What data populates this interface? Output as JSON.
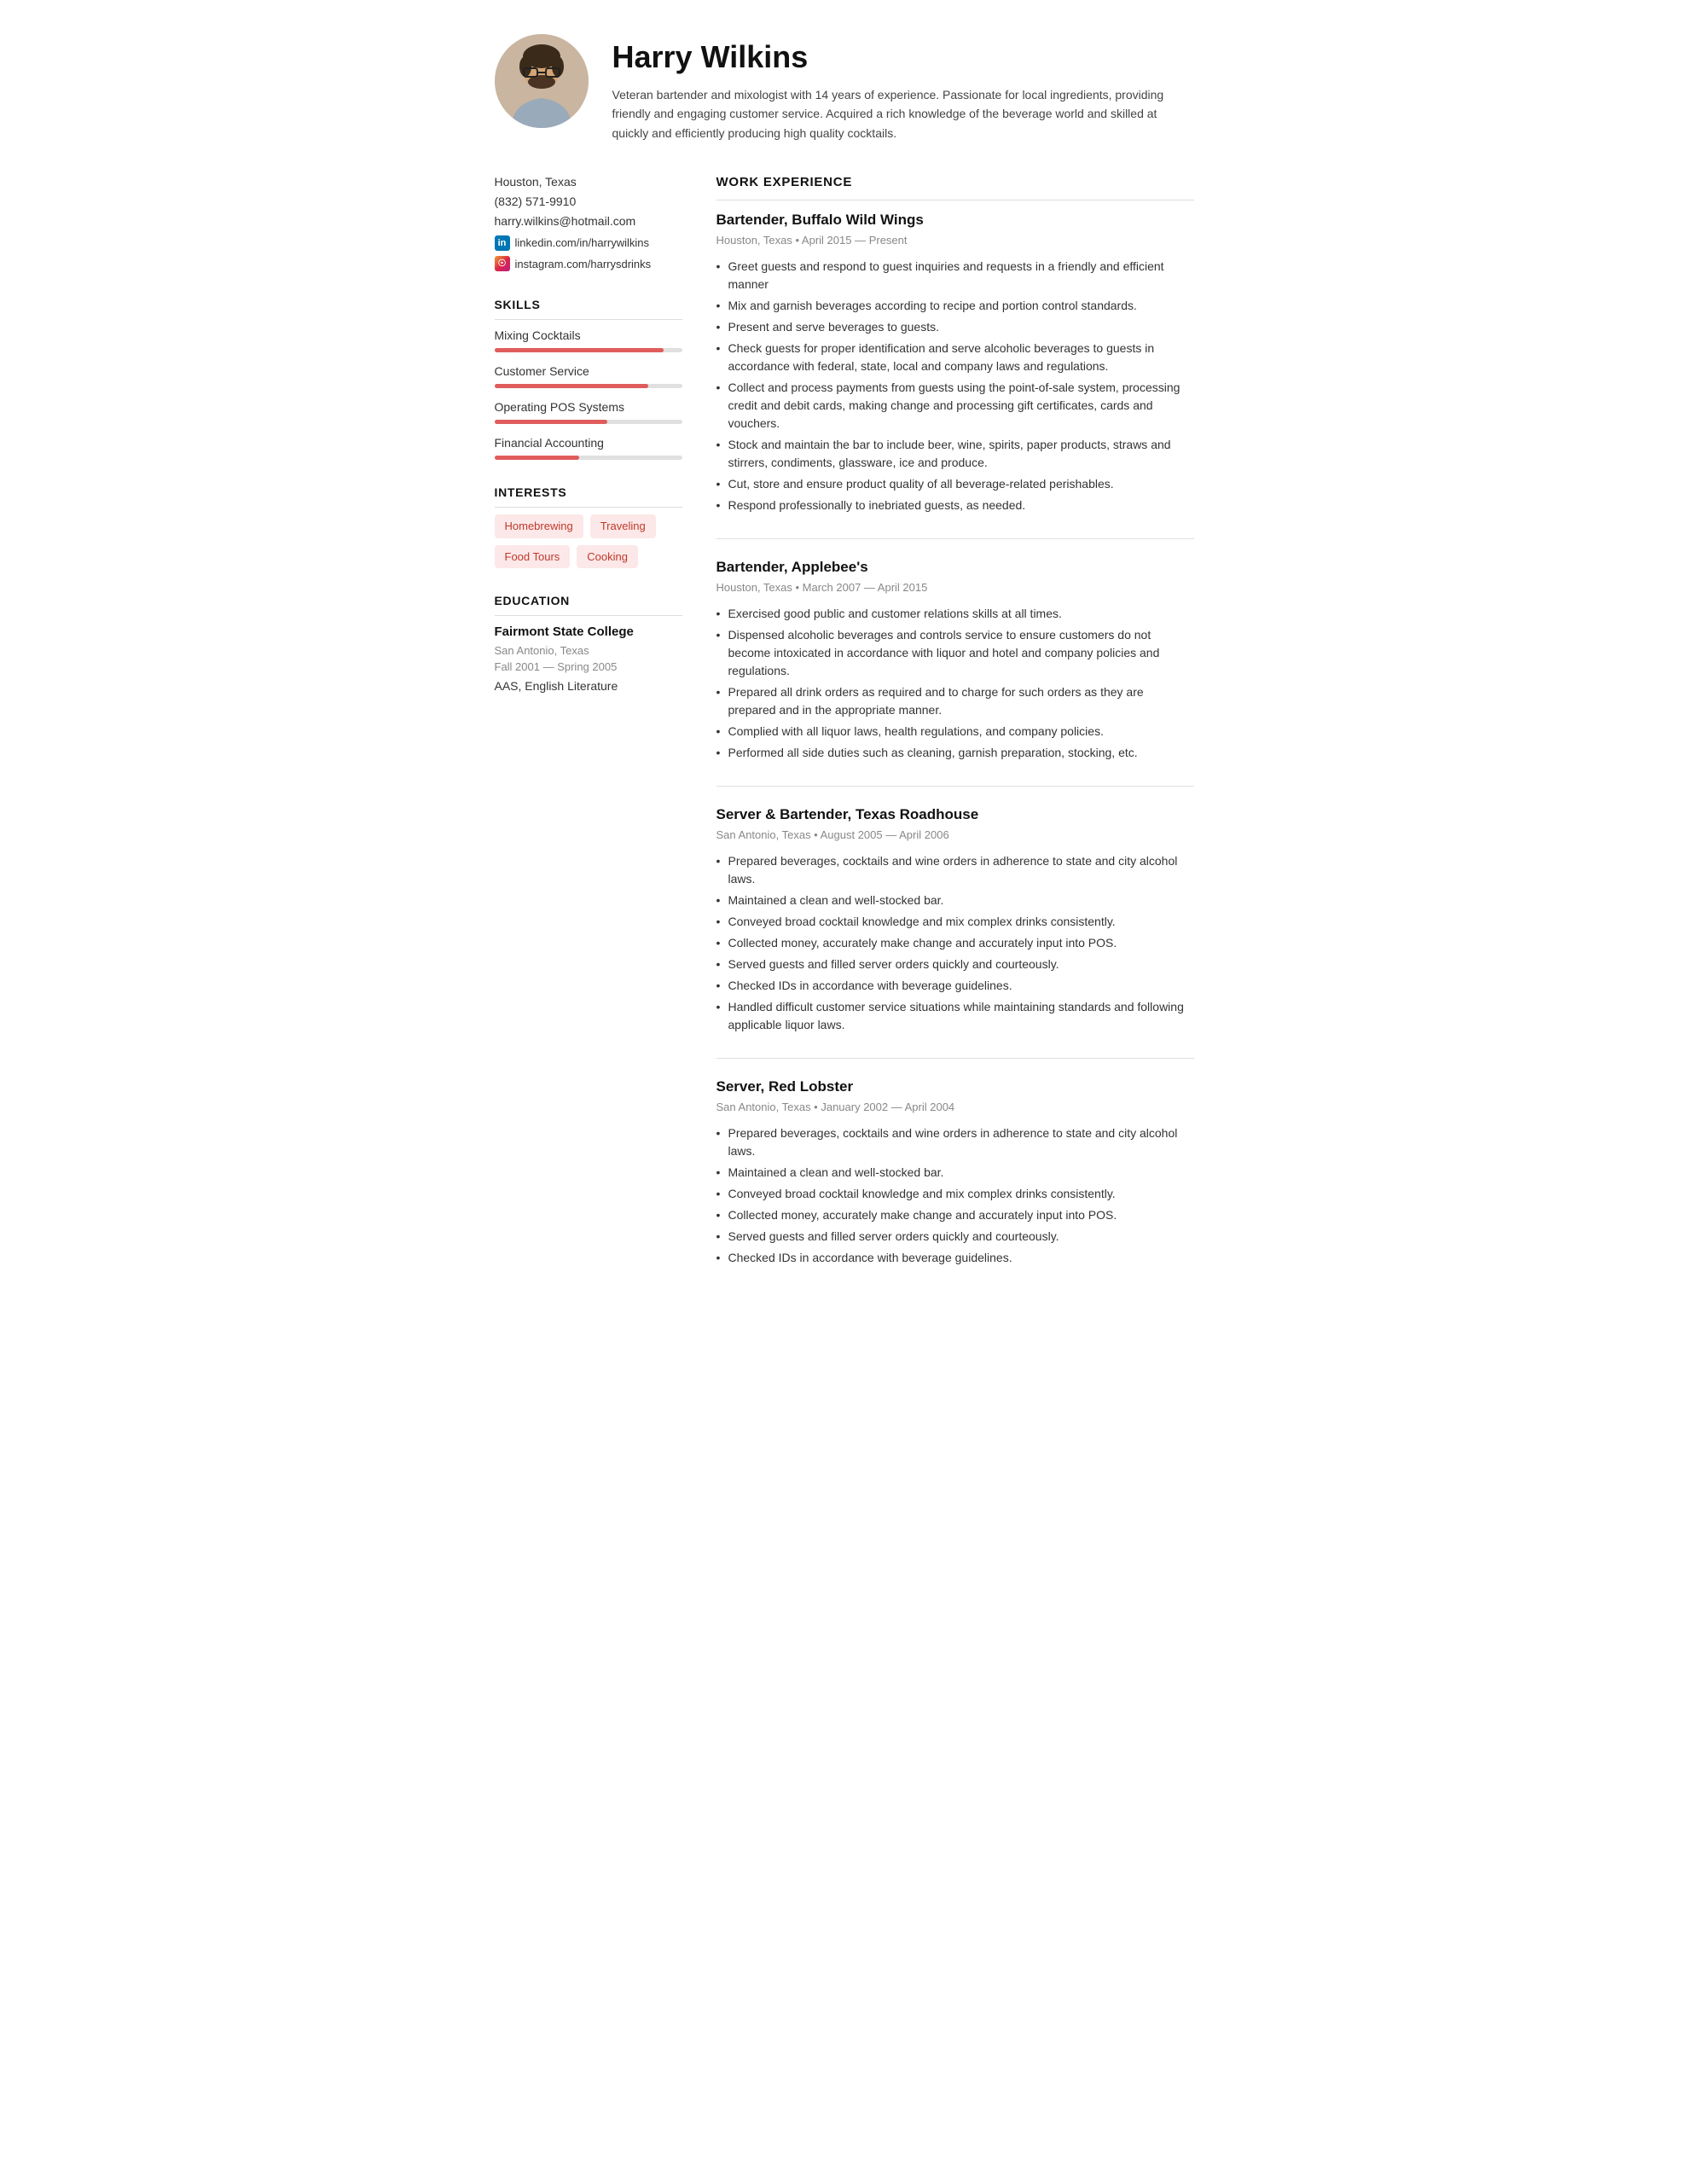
{
  "header": {
    "name": "Harry Wilkins",
    "summary": "Veteran bartender and mixologist with 14 years of experience. Passionate for local ingredients, providing friendly and engaging customer service. Acquired a rich knowledge of the beverage world and skilled at quickly and efficiently producing high quality cocktails."
  },
  "contact": {
    "location": "Houston, Texas",
    "phone": "(832) 571-9910",
    "email": "harry.wilkins@hotmail.com",
    "linkedin": "linkedin.com/in/harrywilkins",
    "instagram": "instagram.com/harrysdrinks"
  },
  "skills": {
    "title": "SKILLS",
    "items": [
      {
        "name": "Mixing Cocktails",
        "percent": 90
      },
      {
        "name": "Customer Service",
        "percent": 82
      },
      {
        "name": "Operating POS Systems",
        "percent": 60
      },
      {
        "name": "Financial Accounting",
        "percent": 45
      }
    ]
  },
  "interests": {
    "title": "INTERESTS",
    "tags": [
      "Homebrewing",
      "Traveling",
      "Food Tours",
      "Cooking"
    ]
  },
  "education": {
    "title": "EDUCATION",
    "school": "Fairmont State College",
    "location": "San Antonio, Texas",
    "dates": "Fall 2001 — Spring 2005",
    "degree": "AAS, English Literature"
  },
  "work": {
    "title": "WORK EXPERIENCE",
    "jobs": [
      {
        "title": "Bartender, Buffalo Wild Wings",
        "meta": "Houston, Texas • April 2015 — Present",
        "bullets": [
          "Greet guests and respond to guest inquiries and requests in a friendly and efficient manner",
          "Mix and garnish beverages according to recipe and portion control standards.",
          "Present and serve beverages to guests.",
          "Check guests for proper identification and serve alcoholic beverages to guests in accordance with federal, state, local and company laws and regulations.",
          "Collect and process payments from guests using the point-of-sale system, processing credit and debit cards, making change and processing gift certificates, cards and vouchers.",
          "Stock and maintain the bar to include beer, wine, spirits, paper products, straws and stirrers, condiments, glassware, ice and produce.",
          "Cut, store and ensure product quality of all beverage-related perishables.",
          "Respond professionally to inebriated guests, as needed."
        ]
      },
      {
        "title": "Bartender, Applebee's",
        "meta": "Houston, Texas • March 2007 — April 2015",
        "bullets": [
          "Exercised good public and customer relations skills at all times.",
          "Dispensed alcoholic beverages and controls service to ensure customers do not become intoxicated in accordance with liquor and hotel and company policies and regulations.",
          "Prepared all drink orders as required and to charge for such orders as they are prepared and in the appropriate manner.",
          "Complied with all liquor laws, health regulations, and company policies.",
          "Performed all side duties such as cleaning, garnish preparation, stocking, etc."
        ]
      },
      {
        "title": "Server & Bartender, Texas Roadhouse",
        "meta": "San Antonio, Texas • August 2005 — April 2006",
        "bullets": [
          "Prepared beverages, cocktails and wine orders in adherence to state and city alcohol laws.",
          "Maintained a clean and well-stocked bar.",
          "Conveyed broad cocktail knowledge and mix complex drinks consistently.",
          "Collected money, accurately make change and accurately input into POS.",
          "Served guests and filled server orders quickly and courteously.",
          "Checked IDs in accordance with beverage guidelines.",
          "Handled difficult customer service situations while maintaining standards and following applicable liquor laws."
        ]
      },
      {
        "title": "Server, Red Lobster",
        "meta": "San Antonio, Texas • January 2002 — April 2004",
        "bullets": [
          "Prepared beverages, cocktails and wine orders in adherence to state and city alcohol laws.",
          "Maintained a clean and well-stocked bar.",
          "Conveyed broad cocktail knowledge and mix complex drinks consistently.",
          "Collected money, accurately make change and accurately input into POS.",
          "Served guests and filled server orders quickly and courteously.",
          "Checked IDs in accordance with beverage guidelines."
        ]
      }
    ]
  }
}
